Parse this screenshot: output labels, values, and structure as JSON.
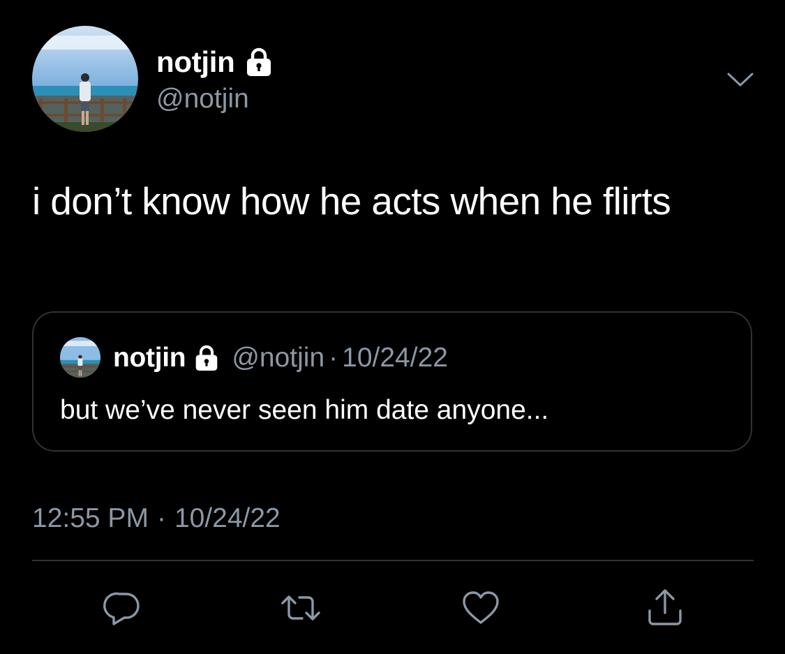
{
  "author": {
    "display_name": "notjin",
    "handle": "@notjin",
    "protected": true
  },
  "tweet": {
    "text": "i don’t know how he acts when he flirts",
    "time": "12:55 PM",
    "separator": "·",
    "date": "10/24/22"
  },
  "quoted_tweet": {
    "display_name": "notjin",
    "handle": "@notjin",
    "separator": "·",
    "date": "10/24/22",
    "text": "but we’ve never seen him date anyone..."
  },
  "icons": {
    "lock": "lock-icon",
    "more": "chevron-down-icon",
    "reply": "reply-icon",
    "retweet": "retweet-icon",
    "like": "heart-icon",
    "share": "share-icon"
  },
  "colors": {
    "background": "#000000",
    "text": "#ffffff",
    "secondary": "#8b98a5",
    "border": "#2f3336"
  }
}
